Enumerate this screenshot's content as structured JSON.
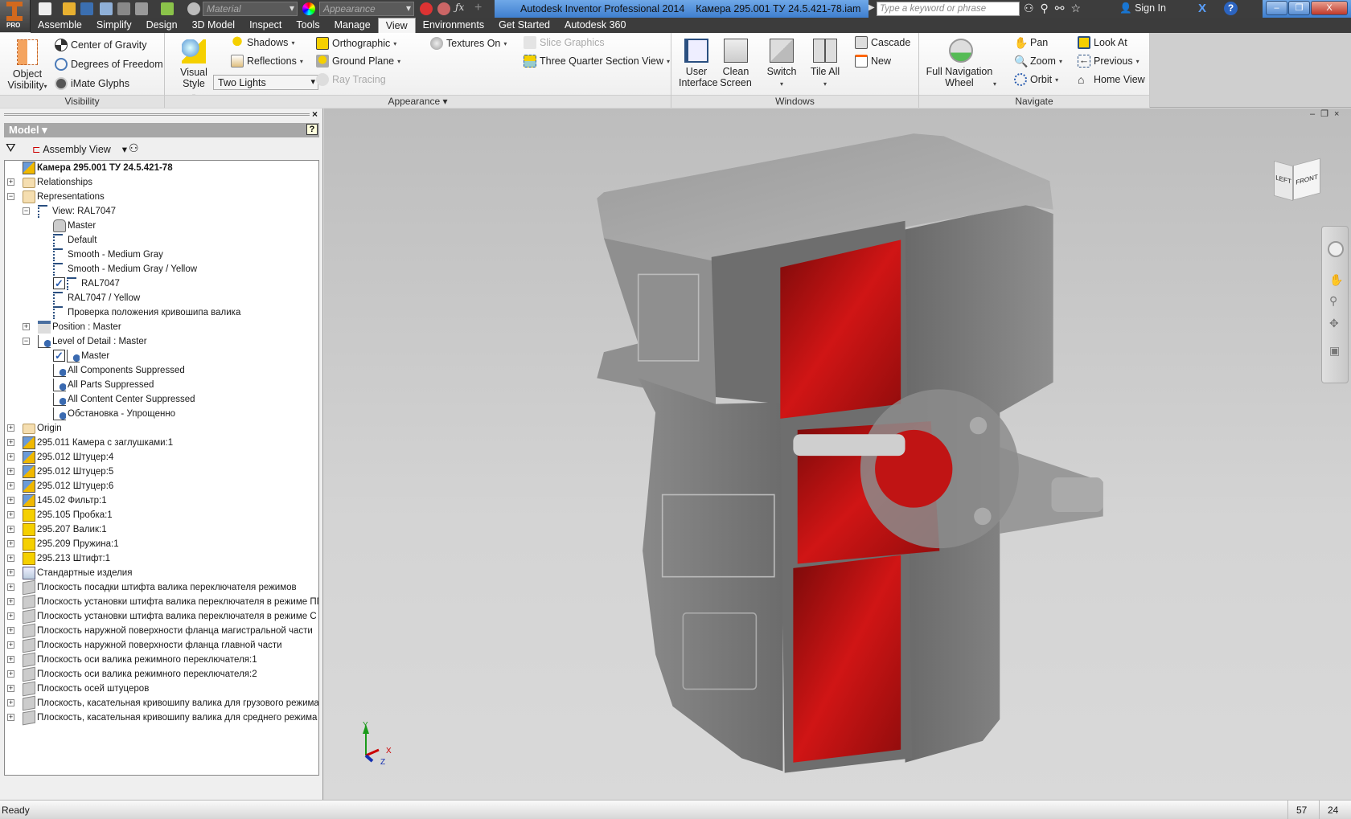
{
  "app": {
    "title": "Autodesk Inventor Professional 2014",
    "document": "Камера 295.001 ТУ 24.5.421-78.iam",
    "app_badge": "PRO"
  },
  "quick_access": {
    "material": "Material",
    "appearance": "Appearance"
  },
  "search": {
    "placeholder": "Type a keyword or phrase"
  },
  "account": {
    "sign_in": "Sign In"
  },
  "window_controls": {
    "minimize": "–",
    "restore": "❐",
    "close": "X"
  },
  "tabs": [
    {
      "label": "Assemble"
    },
    {
      "label": "Simplify"
    },
    {
      "label": "Design"
    },
    {
      "label": "3D Model"
    },
    {
      "label": "Inspect"
    },
    {
      "label": "Tools"
    },
    {
      "label": "Manage"
    },
    {
      "label": "View",
      "active": true
    },
    {
      "label": "Environments"
    },
    {
      "label": "Get Started"
    },
    {
      "label": "Autodesk 360"
    }
  ],
  "ribbon": {
    "visibility": {
      "label": "Visibility",
      "object_visibility": "Object Visibility",
      "center_of_gravity": "Center of Gravity",
      "degrees_of_freedom": "Degrees of Freedom",
      "imate_glyphs": "iMate Glyphs"
    },
    "appearance": {
      "label": "Appearance",
      "visual_style": "Visual Style",
      "shadows": "Shadows",
      "reflections": "Reflections",
      "lighting": "Two Lights",
      "orthographic": "Orthographic",
      "ground_plane": "Ground Plane",
      "ray_tracing": "Ray Tracing",
      "textures": "Textures On",
      "slice_graphics": "Slice Graphics",
      "section_view": "Three Quarter Section View"
    },
    "windows": {
      "label": "Windows",
      "user_interface": "User Interface",
      "clean_screen": "Clean Screen",
      "switch": "Switch",
      "tile_all": "Tile All",
      "cascade": "Cascade",
      "new": "New"
    },
    "navigate": {
      "label": "Navigate",
      "full_nav_wheel": "Full Navigation Wheel",
      "pan": "Pan",
      "zoom": "Zoom",
      "orbit": "Orbit",
      "look_at": "Look At",
      "previous": "Previous",
      "home_view": "Home View"
    }
  },
  "browser": {
    "title": "Model",
    "view_mode": "Assembly View",
    "items": [
      {
        "label": "Камера 295.001 ТУ 24.5.421-78",
        "level": 0,
        "exp": "",
        "icon": "assembly",
        "bold": true
      },
      {
        "label": "Relationships",
        "level": 0,
        "exp": "+",
        "icon": "folder"
      },
      {
        "label": "Representations",
        "level": 0,
        "exp": "-",
        "icon": "folder-rep"
      },
      {
        "label": "View: RAL7047",
        "level": 1,
        "exp": "-",
        "icon": "view"
      },
      {
        "label": "Master",
        "level": 2,
        "exp": "",
        "icon": "lock"
      },
      {
        "label": "Default",
        "level": 2,
        "exp": "",
        "icon": "view"
      },
      {
        "label": "Smooth - Medium Gray",
        "level": 2,
        "exp": "",
        "icon": "view"
      },
      {
        "label": "Smooth - Medium Gray / Yellow",
        "level": 2,
        "exp": "",
        "icon": "view"
      },
      {
        "label": "RAL7047",
        "level": 2,
        "exp": "",
        "icon": "view",
        "checked": true
      },
      {
        "label": "RAL7047 / Yellow",
        "level": 2,
        "exp": "",
        "icon": "view"
      },
      {
        "label": "Проверка положения кривошипа валика",
        "level": 2,
        "exp": "",
        "icon": "view"
      },
      {
        "label": "Position : Master",
        "level": 1,
        "exp": "+",
        "icon": "position"
      },
      {
        "label": "Level of Detail : Master",
        "level": 1,
        "exp": "-",
        "icon": "lod"
      },
      {
        "label": "Master",
        "level": 2,
        "exp": "",
        "icon": "lod",
        "checked": true
      },
      {
        "label": "All Components Suppressed",
        "level": 2,
        "exp": "",
        "icon": "lod"
      },
      {
        "label": "All Parts Suppressed",
        "level": 2,
        "exp": "",
        "icon": "lod"
      },
      {
        "label": "All Content Center Suppressed",
        "level": 2,
        "exp": "",
        "icon": "lod"
      },
      {
        "label": "Обстановка - Упрощенно",
        "level": 2,
        "exp": "",
        "icon": "lod"
      },
      {
        "label": "Origin",
        "level": 0,
        "exp": "+",
        "icon": "folder"
      },
      {
        "label": "295.011 Камера с заглушками:1",
        "level": 0,
        "exp": "+",
        "icon": "assembly"
      },
      {
        "label": "295.012 Штуцер:4",
        "level": 0,
        "exp": "+",
        "icon": "assembly"
      },
      {
        "label": "295.012 Штуцер:5",
        "level": 0,
        "exp": "+",
        "icon": "assembly"
      },
      {
        "label": "295.012 Штуцер:6",
        "level": 0,
        "exp": "+",
        "icon": "assembly"
      },
      {
        "label": "145.02 Фильтр:1",
        "level": 0,
        "exp": "+",
        "icon": "assembly"
      },
      {
        "label": "295.105 Пробка:1",
        "level": 0,
        "exp": "+",
        "icon": "part"
      },
      {
        "label": "295.207 Валик:1",
        "level": 0,
        "exp": "+",
        "icon": "part"
      },
      {
        "label": "295.209 Пружина:1",
        "level": 0,
        "exp": "+",
        "icon": "part"
      },
      {
        "label": "295.213 Штифт:1",
        "level": 0,
        "exp": "+",
        "icon": "part"
      },
      {
        "label": "Стандартные изделия",
        "level": 0,
        "exp": "+",
        "icon": "library"
      },
      {
        "label": "Плоскость посадки штифта валика переключателя режимов",
        "level": 0,
        "exp": "+",
        "icon": "plane"
      },
      {
        "label": "Плоскость установки штифта валика переключателя в режиме ПГ",
        "level": 0,
        "exp": "+",
        "icon": "plane"
      },
      {
        "label": "Плоскость установки штифта валика переключателя в режиме С",
        "level": 0,
        "exp": "+",
        "icon": "plane"
      },
      {
        "label": "Плоскость наружной поверхности фланца магистральной части",
        "level": 0,
        "exp": "+",
        "icon": "plane"
      },
      {
        "label": "Плоскость наружной поверхности фланца главной части",
        "level": 0,
        "exp": "+",
        "icon": "plane"
      },
      {
        "label": "Плоскость оси валика режимного переключателя:1",
        "level": 0,
        "exp": "+",
        "icon": "plane"
      },
      {
        "label": "Плоскость оси валика режимного переключателя:2",
        "level": 0,
        "exp": "+",
        "icon": "plane"
      },
      {
        "label": "Плоскость осей штуцеров",
        "level": 0,
        "exp": "+",
        "icon": "plane"
      },
      {
        "label": "Плоскость, касательная кривошипу валика для грузового режима",
        "level": 0,
        "exp": "+",
        "icon": "plane"
      },
      {
        "label": "Плоскость, касательная кривошипу валика для среднего режима",
        "level": 0,
        "exp": "+",
        "icon": "plane"
      }
    ]
  },
  "viewcube": {
    "left": "LEFT",
    "front": "FRONT"
  },
  "triad": {
    "x": "X",
    "y": "Y",
    "z": "Z"
  },
  "status": {
    "text": "Ready",
    "val1": "57",
    "val2": "24"
  },
  "colors": {
    "section_red": "#c01010",
    "metal": "#8a8a8a",
    "ribbon_tabs": "#3c3c3c"
  }
}
